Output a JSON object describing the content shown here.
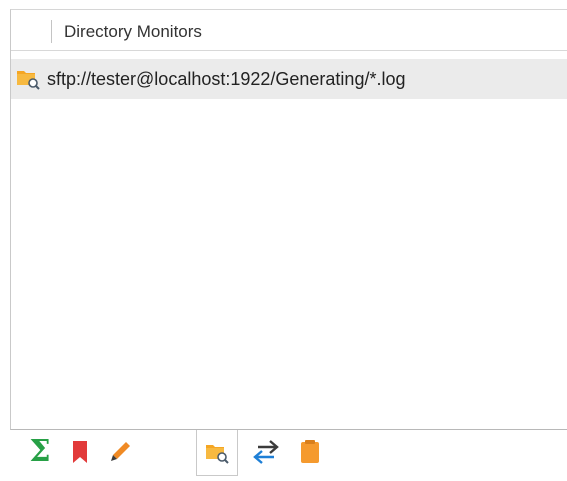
{
  "panel": {
    "header": {
      "title": "Directory Monitors"
    },
    "rows": [
      {
        "icon": "folder-search-icon",
        "path": "sftp://tester@localhost:1922/Generating/*.log"
      }
    ]
  },
  "tabs": [
    {
      "name": "sum-tab",
      "icon": "sigma-icon",
      "glyph": "Σ",
      "active": false
    },
    {
      "name": "bookmarks-tab",
      "icon": "bookmark-icon",
      "active": false
    },
    {
      "name": "edit-tab",
      "icon": "pencil-icon",
      "active": false
    },
    {
      "name": "directory-monitors-tab",
      "icon": "folder-search-icon",
      "active": true
    },
    {
      "name": "transfer-tab",
      "icon": "swap-arrows-icon",
      "active": false
    },
    {
      "name": "notes-tab",
      "icon": "note-icon",
      "active": false
    }
  ],
  "colors": {
    "sigma": "#27a046",
    "bookmark": "#e23a3a",
    "folder": "#f5a623",
    "arrows": "#1e7fd6",
    "note": "#f59a2e"
  }
}
